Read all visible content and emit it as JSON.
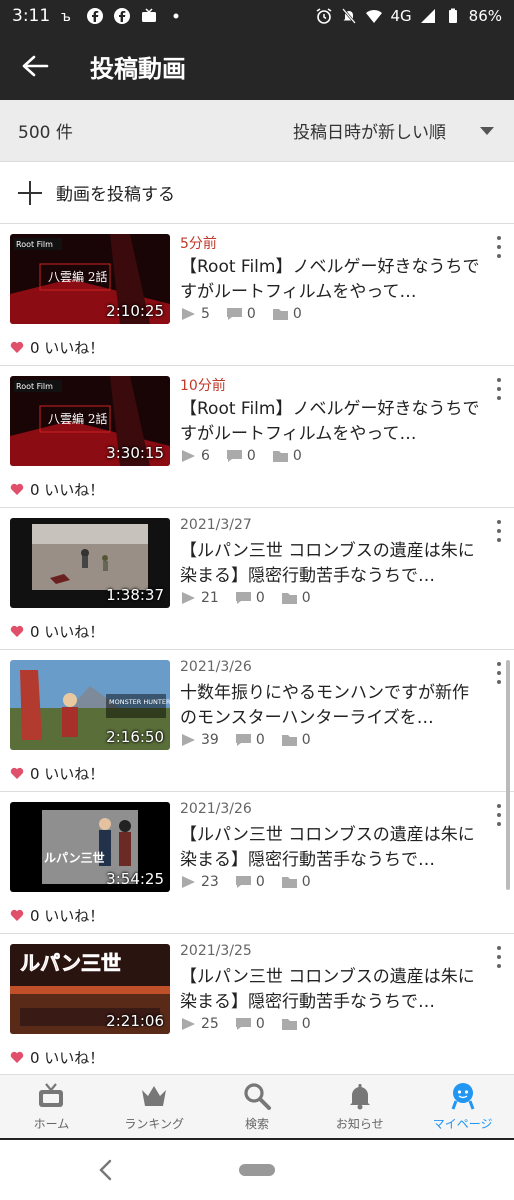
{
  "status": {
    "time": "3:11",
    "network": "4G",
    "battery": "86%"
  },
  "header": {
    "title": "投稿動画"
  },
  "sort": {
    "count": "500 件",
    "order": "投稿日時が新しい順"
  },
  "actions": {
    "post_video": "動画を投稿する"
  },
  "videos": [
    {
      "date": "5分前",
      "title": "【Root Film】ノベルゲー好きなうちですがルートフィルムをやって…",
      "duration": "2:10:25",
      "views": "5",
      "comments": "0",
      "mylists": "0",
      "likes": "0 いいね！",
      "thumb_caption": "八雲編 2話"
    },
    {
      "date": "10分前",
      "title": "【Root Film】ノベルゲー好きなうちですがルートフィルムをやって…",
      "duration": "3:30:15",
      "views": "6",
      "comments": "0",
      "mylists": "0",
      "likes": "0 いいね！",
      "thumb_caption": "八雲編 2話"
    },
    {
      "date": "2021/3/27",
      "title": "【ルパン三世 コロンブスの遺産は朱に染まる】隠密行動苦手なうちで…",
      "duration": "1:38:37",
      "views": "21",
      "comments": "0",
      "mylists": "0",
      "likes": "0 いいね！"
    },
    {
      "date": "2021/3/26",
      "title": "十数年振りにやるモンハンですが新作のモンスターハンターライズを…",
      "duration": "2:16:50",
      "views": "39",
      "comments": "0",
      "mylists": "0",
      "likes": "0 いいね！",
      "thumb_caption": "MONSTER HUNTER RISE"
    },
    {
      "date": "2021/3/26",
      "title": "【ルパン三世 コロンブスの遺産は朱に染まる】隠密行動苦手なうちで…",
      "duration": "3:54:25",
      "views": "23",
      "comments": "0",
      "mylists": "0",
      "likes": "0 いいね！",
      "thumb_caption": "ルパン三世"
    },
    {
      "date": "2021/3/25",
      "title": "【ルパン三世 コロンブスの遺産は朱に染まる】隠密行動苦手なうちで…",
      "duration": "2:21:06",
      "views": "25",
      "comments": "0",
      "mylists": "0",
      "likes": "0 いいね！",
      "thumb_caption": "ルパン三世"
    }
  ],
  "bottom_nav": {
    "home": "ホーム",
    "ranking": "ランキング",
    "search": "検索",
    "notifications": "お知らせ",
    "mypage": "マイページ"
  },
  "colors": {
    "header_bg": "#262626",
    "recent_date": "#c0392b",
    "active_nav": "#2196f3",
    "like_heart": "#e0506a"
  }
}
